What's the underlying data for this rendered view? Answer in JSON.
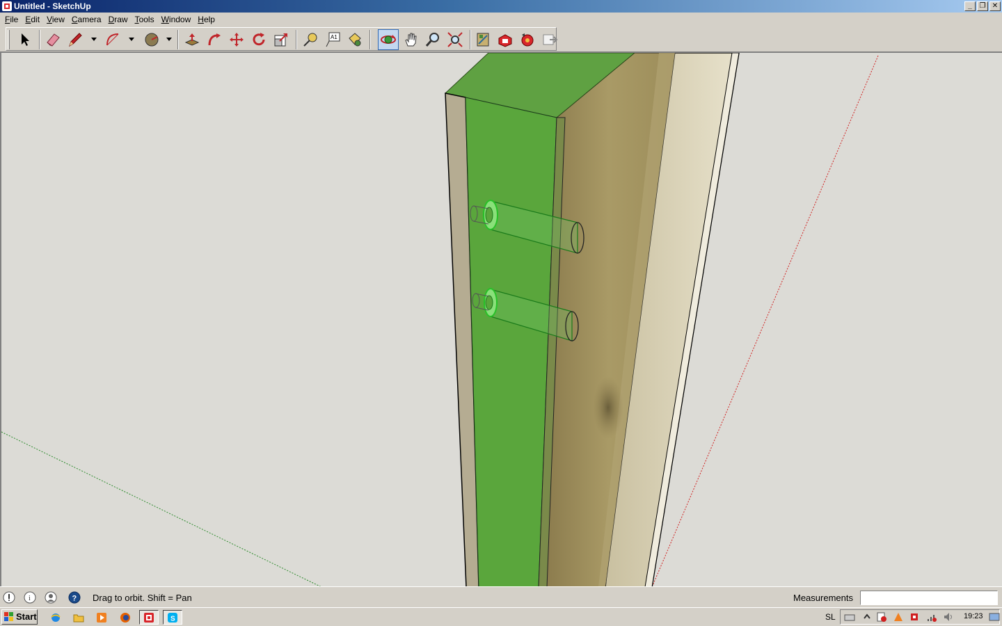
{
  "window": {
    "title": "Untitled - SketchUp",
    "controls": [
      "minimize-icon",
      "restore-icon",
      "close-icon"
    ]
  },
  "menu": [
    {
      "label": "File",
      "mnemonic": "F",
      "rest": "ile"
    },
    {
      "label": "Edit",
      "mnemonic": "E",
      "rest": "dit"
    },
    {
      "label": "View",
      "mnemonic": "V",
      "rest": "iew"
    },
    {
      "label": "Camera",
      "mnemonic": "C",
      "rest": "amera"
    },
    {
      "label": "Draw",
      "mnemonic": "D",
      "rest": "raw"
    },
    {
      "label": "Tools",
      "mnemonic": "T",
      "rest": "ools"
    },
    {
      "label": "Window",
      "mnemonic": "W",
      "rest": "indow"
    },
    {
      "label": "Help",
      "mnemonic": "H",
      "rest": "elp"
    }
  ],
  "toolbar": {
    "tools": [
      {
        "name": "select-tool",
        "icon": "arrow-cursor-icon"
      },
      {
        "name": "eraser-tool",
        "icon": "eraser-icon"
      },
      {
        "name": "line-tool",
        "icon": "pencil-icon"
      },
      {
        "name": "arc-tool",
        "icon": "arc-icon"
      },
      {
        "name": "shapes-tool",
        "icon": "circle-icon"
      },
      {
        "name": "push-pull-tool",
        "icon": "push-pull-icon"
      },
      {
        "name": "follow-me-tool",
        "icon": "follow-me-icon"
      },
      {
        "name": "move-tool",
        "icon": "move-arrows-icon"
      },
      {
        "name": "rotate-tool",
        "icon": "rotate-icon"
      },
      {
        "name": "scale-tool",
        "icon": "scale-icon"
      },
      {
        "name": "tape-measure-tool",
        "icon": "tape-measure-icon"
      },
      {
        "name": "text-tool",
        "icon": "text-label-icon"
      },
      {
        "name": "paint-bucket-tool",
        "icon": "paint-bucket-icon"
      },
      {
        "name": "orbit-tool",
        "icon": "orbit-icon",
        "active": true
      },
      {
        "name": "pan-tool",
        "icon": "hand-icon"
      },
      {
        "name": "zoom-tool",
        "icon": "magnifier-icon"
      },
      {
        "name": "zoom-extents-tool",
        "icon": "zoom-extents-icon"
      },
      {
        "name": "3d-warehouse",
        "icon": "warehouse-icon"
      },
      {
        "name": "share-model",
        "icon": "share-model-icon"
      },
      {
        "name": "extension-warehouse",
        "icon": "extension-warehouse-icon"
      },
      {
        "name": "layout-send",
        "icon": "layout-icon"
      }
    ],
    "text_tool_glyph": "A1"
  },
  "statusbar": {
    "hint": "Drag to orbit.  Shift = Pan",
    "measurements_label": "Measurements",
    "measurements_value": "",
    "icons": [
      "geolocation-icon",
      "credits-icon",
      "user-icon",
      "help-icon"
    ]
  },
  "taskbar": {
    "start_label": "Start",
    "apps": [
      "internet-explorer-icon",
      "explorer-folder-icon",
      "media-player-icon",
      "firefox-icon",
      "sketchup-icon",
      "skype-icon"
    ],
    "language": "SL",
    "time": "19:23"
  },
  "colors": {
    "selection_green": "#5ab03c",
    "wood": "#a0915f",
    "sky": "#dcdbd6",
    "title_blue": "#0a246a"
  }
}
